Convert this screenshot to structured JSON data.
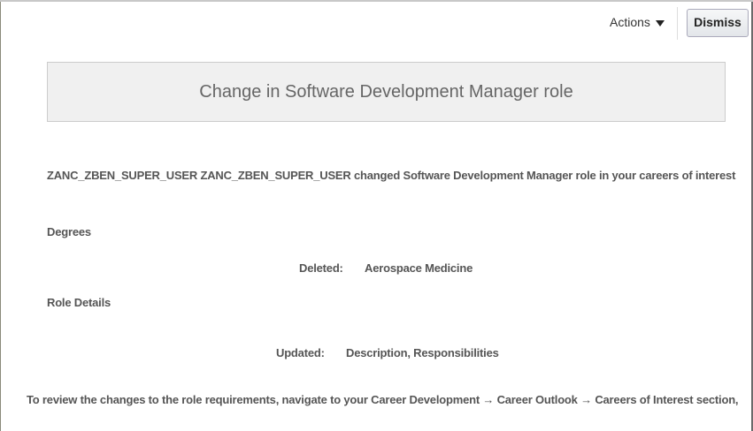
{
  "toolbar": {
    "actions_label": "Actions",
    "dismiss_label": "Dismiss"
  },
  "title": "Change in Software Development Manager role",
  "message": "ZANC_ZBEN_SUPER_USER ZANC_ZBEN_SUPER_USER changed Software Development Manager role in your careers of interest",
  "degrees": {
    "heading": "Degrees",
    "change_label": "Deleted:",
    "change_value": "Aerospace Medicine"
  },
  "role_details": {
    "heading": "Role Details",
    "change_label": "Updated:",
    "change_value": "Description, Responsibilities"
  },
  "footer": "To review the changes to the role requirements, navigate to your Career Development → Career Outlook → Careers of Interest section,"
}
